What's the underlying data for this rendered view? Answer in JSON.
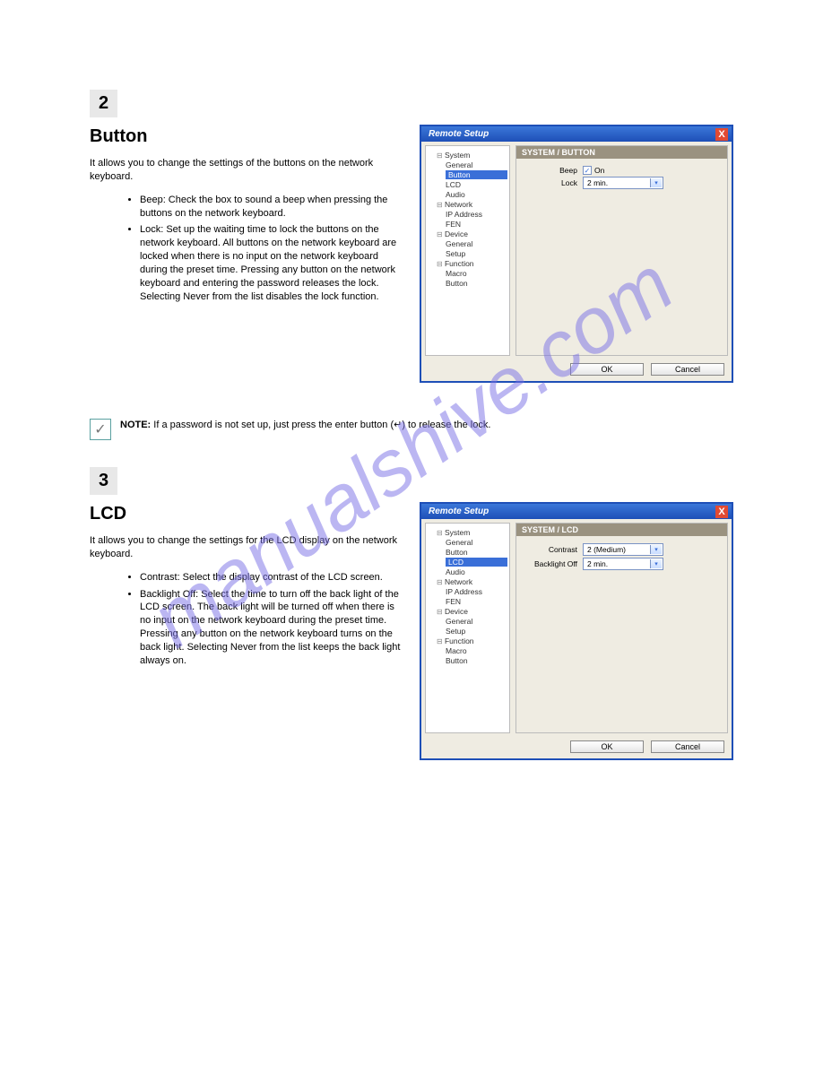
{
  "watermark": "manualshive.com",
  "sections": {
    "button": {
      "number": "2",
      "title": "Button"
    },
    "lcd": {
      "number": "3",
      "title": "LCD"
    }
  },
  "body_paragraphs": {
    "button_intro": "It allows you to change the settings of the buttons on the network keyboard.",
    "lcd_intro": "It allows you to change the settings for the LCD display on the network keyboard."
  },
  "dialog": {
    "title": "Remote Setup",
    "close": "X",
    "ok": "OK",
    "cancel": "Cancel",
    "tree": {
      "system": "System",
      "general": "General",
      "button": "Button",
      "lcd": "LCD",
      "audio": "Audio",
      "network": "Network",
      "ip_address": "IP Address",
      "fen": "FEN",
      "device": "Device",
      "dev_general": "General",
      "dev_setup": "Setup",
      "function": "Function",
      "macro": "Macro",
      "fn_button": "Button"
    },
    "panel_button": {
      "header": "SYSTEM / BUTTON",
      "beep_label": "Beep",
      "beep_cb_label": "On",
      "lock_label": "Lock",
      "lock_value": "2 min."
    },
    "panel_lcd": {
      "header": "SYSTEM / LCD",
      "contrast_label": "Contrast",
      "contrast_value": "2 (Medium)",
      "backlight_label": "Backlight Off",
      "backlight_value": "2 min."
    }
  },
  "bullets": {
    "button": {
      "beep": "Beep: Check the box to sound a beep when pressing the buttons on the network keyboard.",
      "lock": "Lock: Set up the waiting time to lock the buttons on the network keyboard. All buttons on the network keyboard are locked when there is no input on the network keyboard during the preset time. Pressing any button on the network keyboard and entering the password releases the lock. Selecting Never from the list disables the lock function."
    },
    "lcd": {
      "contrast": "Contrast: Select the display contrast of the LCD screen.",
      "backlight": "Backlight Off: Select the time to turn off the back light of the LCD screen. The back light will be turned off when there is no input on the network keyboard during the preset time. Pressing any button on the network keyboard turns on the back light. Selecting Never from the list keeps the back light always on."
    }
  },
  "note": {
    "label": "NOTE:",
    "text": " If a password is not set up, just press the enter button (↵) to release the lock."
  }
}
